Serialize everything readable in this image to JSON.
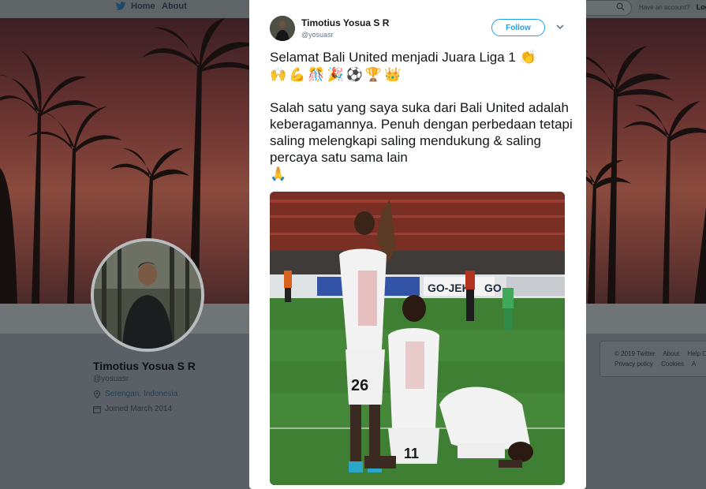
{
  "topnav": {
    "home_label": "Home",
    "about_label": "About",
    "account_prompt": "Have an account?",
    "login_label": "Log i"
  },
  "profile": {
    "name": "Timotius Yosua S R",
    "handle": "@yosuasr",
    "location": "Serengan, Indonesia",
    "joined": "Joined March 2014"
  },
  "footer": {
    "line1": [
      "© 2019 Twitter",
      "About",
      "Help Ce"
    ],
    "line2": [
      "Privacy policy",
      "Cookies",
      "A"
    ]
  },
  "tweet": {
    "author_name": "Timotius Yosua S R",
    "author_handle": "@yosuasr",
    "follow_label": "Follow",
    "line1": "Selamat Bali United menjadi Juara Liga 1",
    "line1_emoji": "👏",
    "emoji_row": [
      "🙌",
      "💪",
      "🎊",
      "🎉",
      "⚽",
      "🏆",
      "👑"
    ],
    "paragraph2": "Salah satu yang saya suka dari Bali United adalah keberagamannya. Penuh dengan perbedaan tetapi saling melengkapi saling mendukung & saling percaya satu sama lain",
    "paragraph2_emoji": "🙏",
    "photo": {
      "jersey_numbers": [
        "26",
        "11"
      ],
      "board_text": [
        "GO-JEK",
        "GO"
      ]
    }
  },
  "colors": {
    "twitter_blue": "#1da1f2",
    "overlay_dim": "#5f6467",
    "banner_sky": "#8a4a3d"
  }
}
